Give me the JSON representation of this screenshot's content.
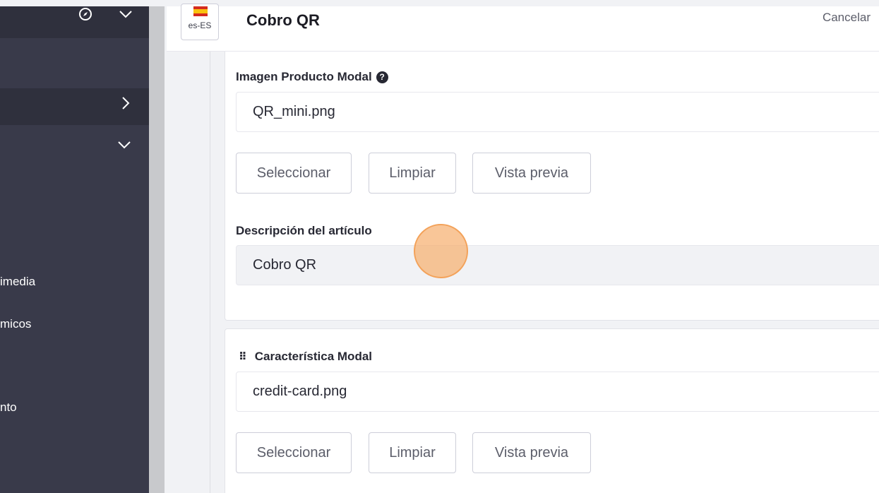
{
  "sidebar": {
    "items": [
      {
        "label": "imedia"
      },
      {
        "label": "micos"
      },
      {
        "label": "nto"
      }
    ]
  },
  "header": {
    "language_code": "es-ES",
    "title": "Cobro QR",
    "cancel_label": "Cancelar"
  },
  "form": {
    "image_field": {
      "label": "Imagen Producto Modal",
      "value": "QR_mini.png",
      "buttons": {
        "select": "Seleccionar",
        "clear": "Limpiar",
        "preview": "Vista previa"
      }
    },
    "description_field": {
      "label": "Descripción del artículo",
      "value": "Cobro QR"
    },
    "feature_field": {
      "label": "Característica Modal",
      "value": "credit-card.png",
      "buttons": {
        "select": "Seleccionar",
        "clear": "Limpiar",
        "preview": "Vista previa"
      }
    }
  },
  "colors": {
    "sidebar_bg": "#393a4a",
    "sidebar_highlight": "#2f303d",
    "content_bg": "#f1f2f5",
    "flag_red": "#d52b1e",
    "flag_yellow": "#f9c20f",
    "cursor_highlight": "#f7b070"
  },
  "icons": [
    "compass-icon",
    "chevron-down-icon",
    "chevron-right-icon",
    "help-icon",
    "drag-handle-icon",
    "spain-flag-icon"
  ]
}
